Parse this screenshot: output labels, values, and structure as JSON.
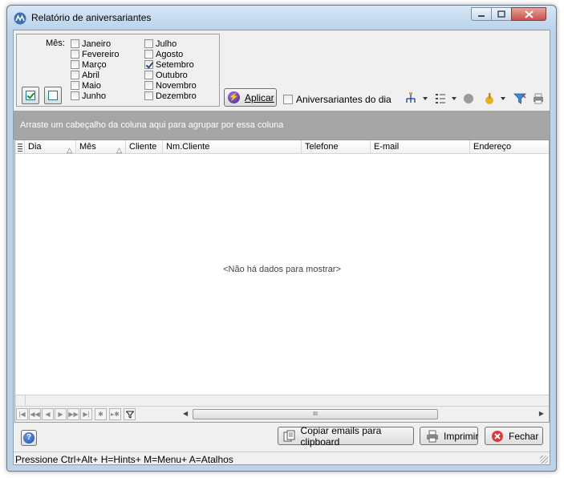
{
  "window": {
    "title": "Relatório de aniversariantes"
  },
  "months": {
    "label": "Mês:",
    "left": [
      {
        "name": "Janeiro",
        "checked": false
      },
      {
        "name": "Fevereiro",
        "checked": false
      },
      {
        "name": "Março",
        "checked": false
      },
      {
        "name": "Abril",
        "checked": false
      },
      {
        "name": "Maio",
        "checked": false
      },
      {
        "name": "Junho",
        "checked": false
      }
    ],
    "right": [
      {
        "name": "Julho",
        "checked": false
      },
      {
        "name": "Agosto",
        "checked": false
      },
      {
        "name": "Setembro",
        "checked": true
      },
      {
        "name": "Outubro",
        "checked": false
      },
      {
        "name": "Novembro",
        "checked": false
      },
      {
        "name": "Dezembro",
        "checked": false
      }
    ]
  },
  "toolbar": {
    "apply_label": "Aplicar",
    "birthday_today_label": "Aniversariantes do dia"
  },
  "grid": {
    "group_hint": "Arraste um cabeçalho da coluna aqui para agrupar por essa coluna",
    "columns": [
      "Dia",
      "Mês",
      "Cliente",
      "Nm.Cliente",
      "Telefone",
      "E-mail",
      "Endereço"
    ],
    "empty_message": "<Não há dados para mostrar>",
    "scroll_grip": "III"
  },
  "buttons": {
    "copy_emails": "Copiar emails para clipboard",
    "print": "Imprimir",
    "close": "Fechar"
  },
  "status": {
    "text": "Pressione Ctrl+Alt+ H=Hints+ M=Menu+ A=Atalhos"
  },
  "colors": {
    "title_bg": "#bcd3ea",
    "group_bar": "#a5a5a5",
    "close_btn": "#c75050"
  }
}
